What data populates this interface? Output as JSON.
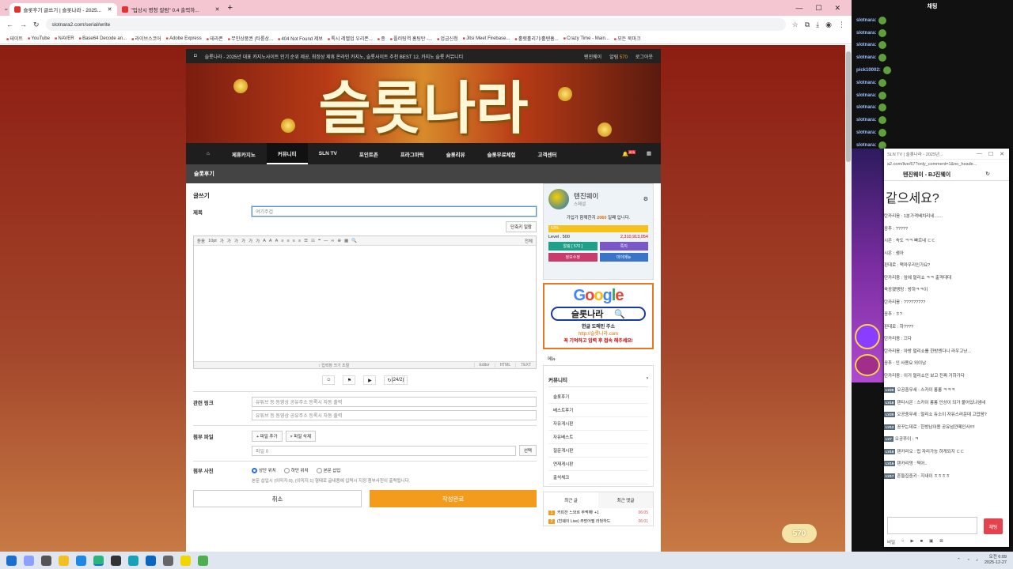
{
  "browser": {
    "tabs": [
      {
        "title": "슬롯후기 글쓰기 | 슬롯나라 - 2025..."
      },
      {
        "title": "\"입상시 명청 컬럼\" 0.4 출력하..."
      }
    ],
    "url": "slotnara2.com/serial/write",
    "bookmarks": [
      "테이트",
      "YouTube",
      "NAVER",
      "Base64 Decode an...",
      "라이브스코어",
      "Adobe Express",
      "테라폰",
      "무인상품권 (타룸상...",
      "404 Not Found 제보",
      "톡시 레벨업 우리폰...",
      "종",
      "플러팅역 홈팅탄 -...",
      "업금신청",
      "Jitsi Meet Firebase...",
      "홀렛홀리기/홀텐홈...",
      "Crazy Time - Main...",
      "모든 북마크"
    ]
  },
  "site": {
    "topbar_text": "슬롯나라 - 2025년 대표 카지노사이트 인기 순위 제공, 최정상 제휴 온라인 카지노, 슬롯사이트 추천 BEST 12, 카지노 슬롯 커뮤니티",
    "topbar_user": "텐진웨이",
    "topbar_alarm": "알림",
    "topbar_alarm_count": "570",
    "topbar_logout": "로그아웃",
    "banner_logo": "슬롯나라",
    "nav": [
      "제휴카지노",
      "커뮤니티",
      "SLN TV",
      "포인트존",
      "프라그마틱",
      "슬롯리뷰",
      "슬롯무료체험",
      "고객센터"
    ],
    "nav_active": "커뮤니티",
    "nav_badge": "570",
    "subhead": "슬롯후기",
    "form": {
      "heading": "글쓰기",
      "title_label": "제목",
      "title_value": "여기주겁",
      "shortcut_btn": "단축키 일람",
      "toolbar": [
        "돋움",
        "10pt",
        "가",
        "가",
        "가",
        "가",
        "가",
        "가",
        "A",
        "A",
        "A",
        "≡",
        "≡",
        "≡",
        "≡",
        "☰",
        "☷",
        "❝",
        "—",
        "∞",
        "⊕",
        "▦",
        "🔍"
      ],
      "fullscreen": "전체",
      "editor_foot_mid": "↕ 입력창 크기 조절",
      "editor_modes": [
        "Editor",
        "HTML",
        "TEXT"
      ],
      "counter": "(24/2)",
      "link_label": "관련 링크",
      "link_ph1": "유튜브 등 동영상 공유주소 등록시 자동 출력",
      "link_ph2": "유튜브 등 동영상 공유주소 등록시 자동 출력",
      "file_label": "첨부 파일",
      "file_add": "+ 파일 추가",
      "file_del": "× 파일 삭제",
      "file_count": "파일 0",
      "file_select": "선택",
      "photo_label": "첨부 사진",
      "photo_opts": [
        "상단 위치",
        "하단 위치",
        "본문 삽입"
      ],
      "photo_note": "본문 삽입시 {이미지:0}, {이미지:1} 형태로 글내용에 입력시 지정 첨부사진이 출력됩니다.",
      "cancel": "취소",
      "submit": "작성완료"
    },
    "profile": {
      "name": "텐진웨이",
      "rank": "스페셜",
      "text_pre": "가입가 함께한지 ",
      "days": "2060",
      "text_post": " 일째 입니다.",
      "bar": "53%",
      "level": "Level . 500",
      "points": "2,310,913,054",
      "buttons": [
        "알림 [ 570 ]",
        "쪽지",
        "정보수정",
        "마이메뉴"
      ]
    },
    "ad": {
      "google": "Google",
      "box": "슬롯나라",
      "line1": "한글 도메인 주소",
      "line2": "http://슬롯나라.com",
      "line3": "꼭 기억하고 입력 후 접속 해주세요!"
    },
    "side_heading": "메뉴",
    "side_section": "커뮤니티",
    "side_links": [
      "슬롯후기",
      "베스트후기",
      "자유게시판",
      "자유베스트",
      "질문게시판",
      "연재게시판",
      "출석체크"
    ],
    "recent_tabs": [
      "최근 글",
      "최근 댓글"
    ],
    "recent": [
      {
        "n": "1",
        "t": "커피잔 느와르 부쩍해! +1",
        "d": "06:05"
      },
      {
        "n": "2",
        "t": "(친웨이 Live) 주망어필 라벗하드",
        "d": "06:01"
      }
    ],
    "floating_badge": "570"
  },
  "chat": {
    "title": "채팅",
    "users": [
      "slotnara:",
      "slotnara:",
      "slotnara:",
      "slotnara:",
      "pick10002:",
      "slotnara:",
      "slotnara:",
      "slotnara:",
      "slotnara:",
      "slotnara:",
      "slotnara:"
    ],
    "popup_tab": "SLN TV | 슬롯나라 - 2025년...",
    "popup_url": "a2.com/live/67?only_comment=1&no_heade...",
    "popup_title": "텐진웨이 - BJ진웨이",
    "popup_big": "같으세요?",
    "messages": [
      "탄카리옹 : 1분가격배치리네.......",
      "꽁추 : ?????",
      "시온 : 속도 ㅋㅋ 빠르네 ㄷㄷ",
      "시온 : 샘아",
      "핀데로 : 맥마우리인가요?",
      "탄카리옹 : 앞에 멀리쇼 ㅋㅋ 출격대대",
      "욱꽁됐땡망 : 방하ㅋㅋ이",
      "탄카리옹 : ?????????",
      "꽁추 : ㅎ?",
      "핀데로 : 하????",
      "탄카리옹 : 끄다",
      "탄카리옹 : 아방 멀리쇼를 한방엔다니 라우고냥...",
      "꽁추 : 인 사용요 외이남",
      "탄카리옹 : 이거 멀리쇼인 보고 진짜 거하가다"
    ],
    "messages2": [
      {
        "lv": "LV20",
        "t": "오공중무세 : 스카이 롱롱 ㅋㅋㅋ"
      },
      {
        "lv": "LV18",
        "t": "텐타시온 : 스카이 롱롱 인상이 되가 붙어있냐넴네"
      },
      {
        "lv": "LV20",
        "t": "오공중무세 : 멀리쇼 듀소이 자유스러운데 고맙음?"
      },
      {
        "lv": "LV12",
        "t": "꽁꾸는데로 : 한방남이용 공유넘깐떼인사!!!!"
      },
      {
        "lv": "LV7",
        "t": "오공쭈이 : ㅋ"
      },
      {
        "lv": "LV19",
        "t": "텐카리오 : 멉 자리가능 하게되지 ㄷㄷ"
      },
      {
        "lv": "LV15",
        "t": "텐카리멍 : 찍어.."
      },
      {
        "lv": "LV17",
        "t": "흔들집중키 : 지내이 ㅎㅎㅎㅎ"
      }
    ],
    "send": "채팅",
    "footer": [
      "비밀",
      "○",
      "▶",
      "■",
      "▣",
      "⊠"
    ]
  },
  "taskbar": {
    "time": "오전 6:09",
    "date": "2025-12-27"
  }
}
